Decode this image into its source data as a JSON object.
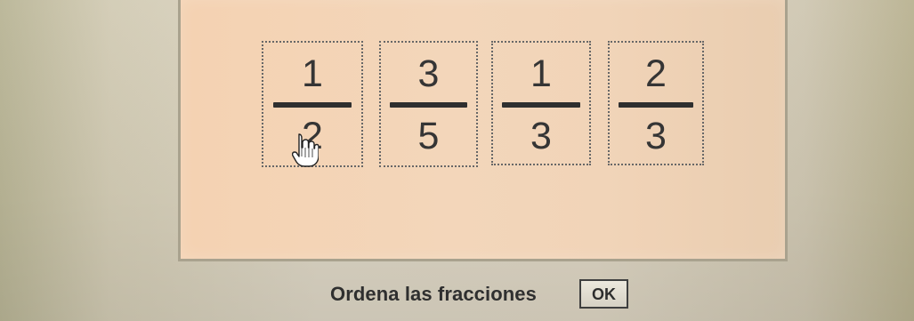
{
  "cards": [
    {
      "numerator": "1",
      "denominator": "2"
    },
    {
      "numerator": "3",
      "denominator": "5"
    },
    {
      "numerator": "1",
      "denominator": "3"
    },
    {
      "numerator": "2",
      "denominator": "3"
    }
  ],
  "instruction": "Ordena las fracciones",
  "ok_label": "OK",
  "icons": {
    "cursor": "hand-pointer-icon"
  },
  "colors": {
    "panel": "#f3d6ba",
    "background": "#ddd6c5",
    "text": "#353535"
  }
}
